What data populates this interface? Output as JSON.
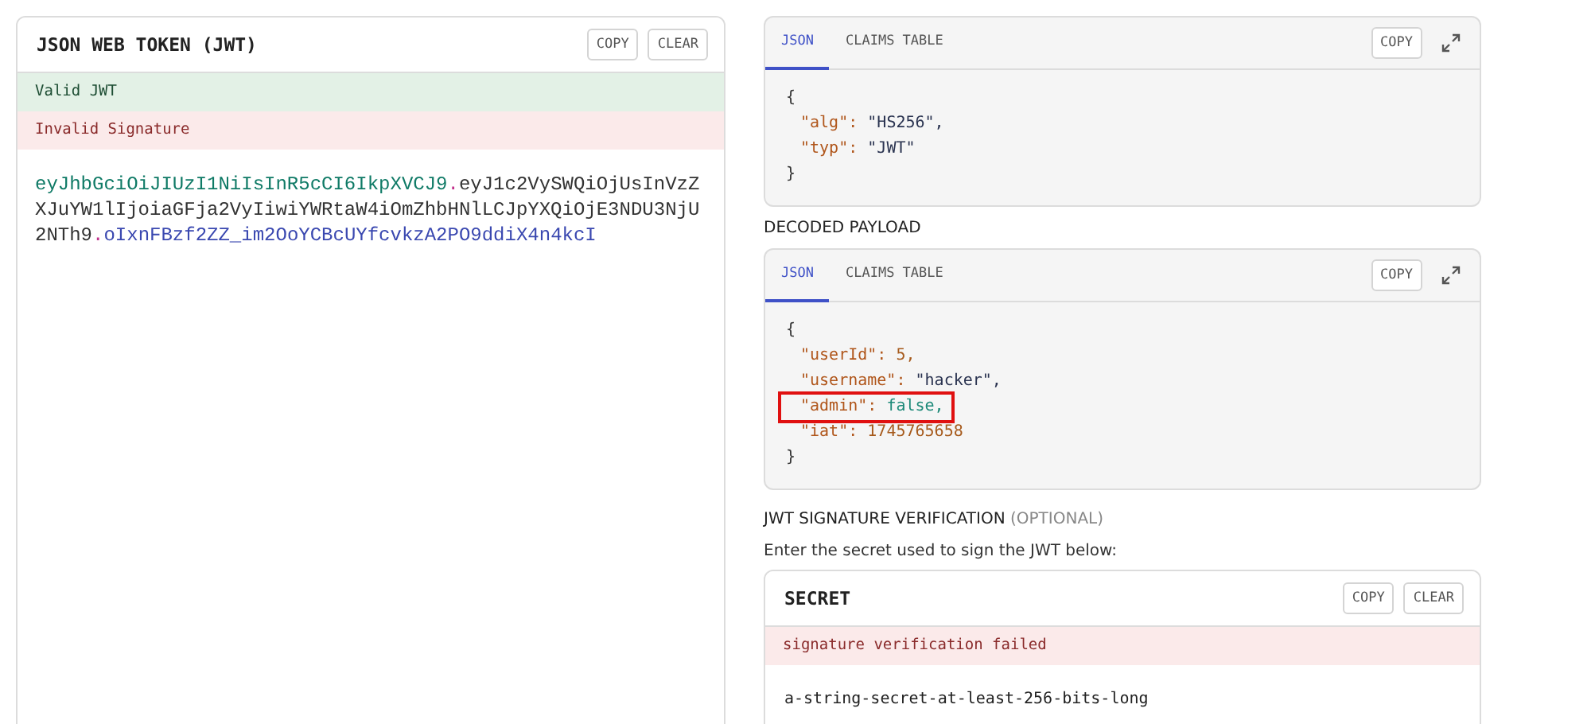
{
  "token_panel": {
    "title": "JSON WEB TOKEN (JWT)",
    "buttons": [
      "COPY",
      "CLEAR"
    ],
    "statuses": [
      {
        "text": "Valid JWT",
        "kind": "ok"
      },
      {
        "text": "Invalid Signature",
        "kind": "error"
      }
    ],
    "token": [
      {
        "text": "eyJhbGciOiJIUzI1NiIsInR5cCI6IkpXVCJ9",
        "kind": "header"
      },
      {
        "text": ".",
        "kind": "dot"
      },
      {
        "text": "eyJ1c2VySWQiOjUsInVzZXJuYW1lIjoiaGFja2VyIiwiYWRtaW4iOmZhbHNlLCJpYXQiOjE3NDU3NjU2NTh9",
        "kind": "payload"
      },
      {
        "text": ".",
        "kind": "dot"
      },
      {
        "text": "oIxnFBzf2ZZ_im2OoYCBcUYfcvkzA2PO9ddiX4n4kcI",
        "kind": "signature"
      }
    ]
  },
  "header_panel": {
    "tabs": [
      {
        "label": "JSON",
        "selected": true
      },
      {
        "label": "CLAIMS TABLE",
        "selected": false
      }
    ],
    "copy": "COPY",
    "json": {
      "open": "{",
      "close": "}",
      "lines": [
        {
          "key": "\"alg\":",
          "value": "\"HS256\",",
          "kind": "string",
          "highlighted": false
        },
        {
          "key": "\"typ\":",
          "value": "\"JWT\"",
          "kind": "string",
          "highlighted": false
        }
      ]
    }
  },
  "payload_heading": "DECODED PAYLOAD",
  "payload_panel": {
    "tabs": [
      {
        "label": "JSON",
        "selected": true
      },
      {
        "label": "CLAIMS TABLE",
        "selected": false
      }
    ],
    "copy": "COPY",
    "json": {
      "open": "{",
      "close": "}",
      "lines": [
        {
          "key": "\"userId\":",
          "value": "5,",
          "kind": "number",
          "highlighted": false
        },
        {
          "key": "\"username\":",
          "value": "\"hacker\",",
          "kind": "string",
          "highlighted": false
        },
        {
          "key": "\"admin\":",
          "value": "false,",
          "kind": "boolean",
          "highlighted": true
        },
        {
          "key": "\"iat\":",
          "value": "1745765658",
          "kind": "number",
          "highlighted": false
        }
      ]
    }
  },
  "verification": {
    "heading": "JWT SIGNATURE VERIFICATION",
    "optional": "(OPTIONAL)",
    "instruction": "Enter the secret used to sign the JWT below:"
  },
  "secret_panel": {
    "title": "SECRET",
    "buttons": [
      "COPY",
      "CLEAR"
    ],
    "status": {
      "text": "signature verification failed",
      "kind": "error"
    },
    "value": "a-string-secret-at-least-256-bits-long"
  }
}
